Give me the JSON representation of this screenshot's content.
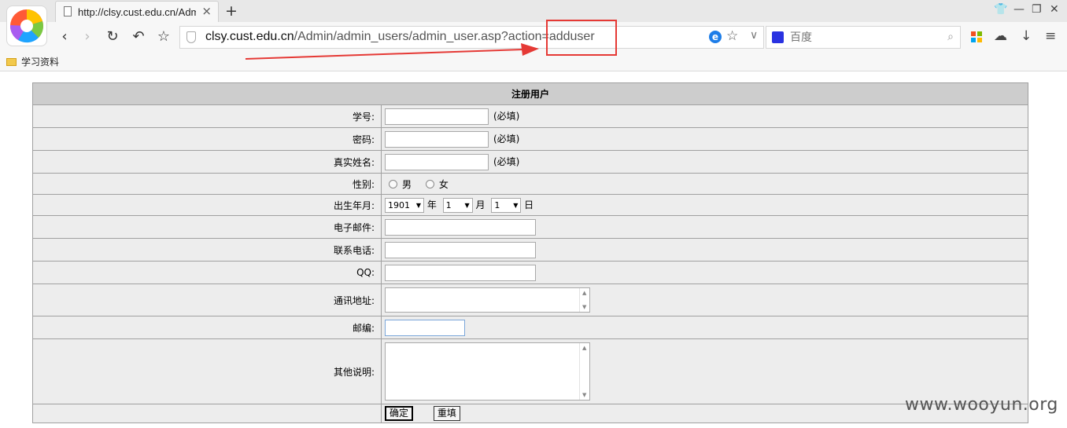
{
  "browser": {
    "tab_title": "http://clsy.cust.edu.cn/Admin/admin_users/admin_user.asp?action=adduser",
    "url_host": "clsy.cust.edu.cn",
    "url_path": "/Admin/admin_users/admin_user.asp?action=adduser",
    "search_placeholder": "百度",
    "bookmark_label": "学习资料",
    "icons": [
      "back-icon",
      "forward-icon",
      "reload-icon",
      "undo-icon",
      "star-icon",
      "shield-icon",
      "ie-icon",
      "search-icon",
      "apps-icon",
      "cloud-icon",
      "download-icon",
      "menu-icon",
      "folder-icon",
      "skin-icon"
    ]
  },
  "form": {
    "title": "注册用户",
    "student_id_label": "学号:",
    "password_label": "密码:",
    "realname_label": "真实姓名:",
    "required_hint": "(必填)",
    "gender_label": "性别:",
    "gender_male": "男",
    "gender_female": "女",
    "birth_label": "出生年月:",
    "birth_year": "1901",
    "year_unit": "年",
    "birth_month": "1",
    "month_unit": "月",
    "birth_day": "1",
    "day_unit": "日",
    "email_label": "电子邮件:",
    "phone_label": "联系电话:",
    "qq_label": "QQ:",
    "address_label": "通讯地址:",
    "zip_label": "邮编:",
    "notes_label": "其他说明:",
    "submit_label": "确定",
    "reset_label": "重填"
  },
  "watermark": "www.wooyun.org"
}
